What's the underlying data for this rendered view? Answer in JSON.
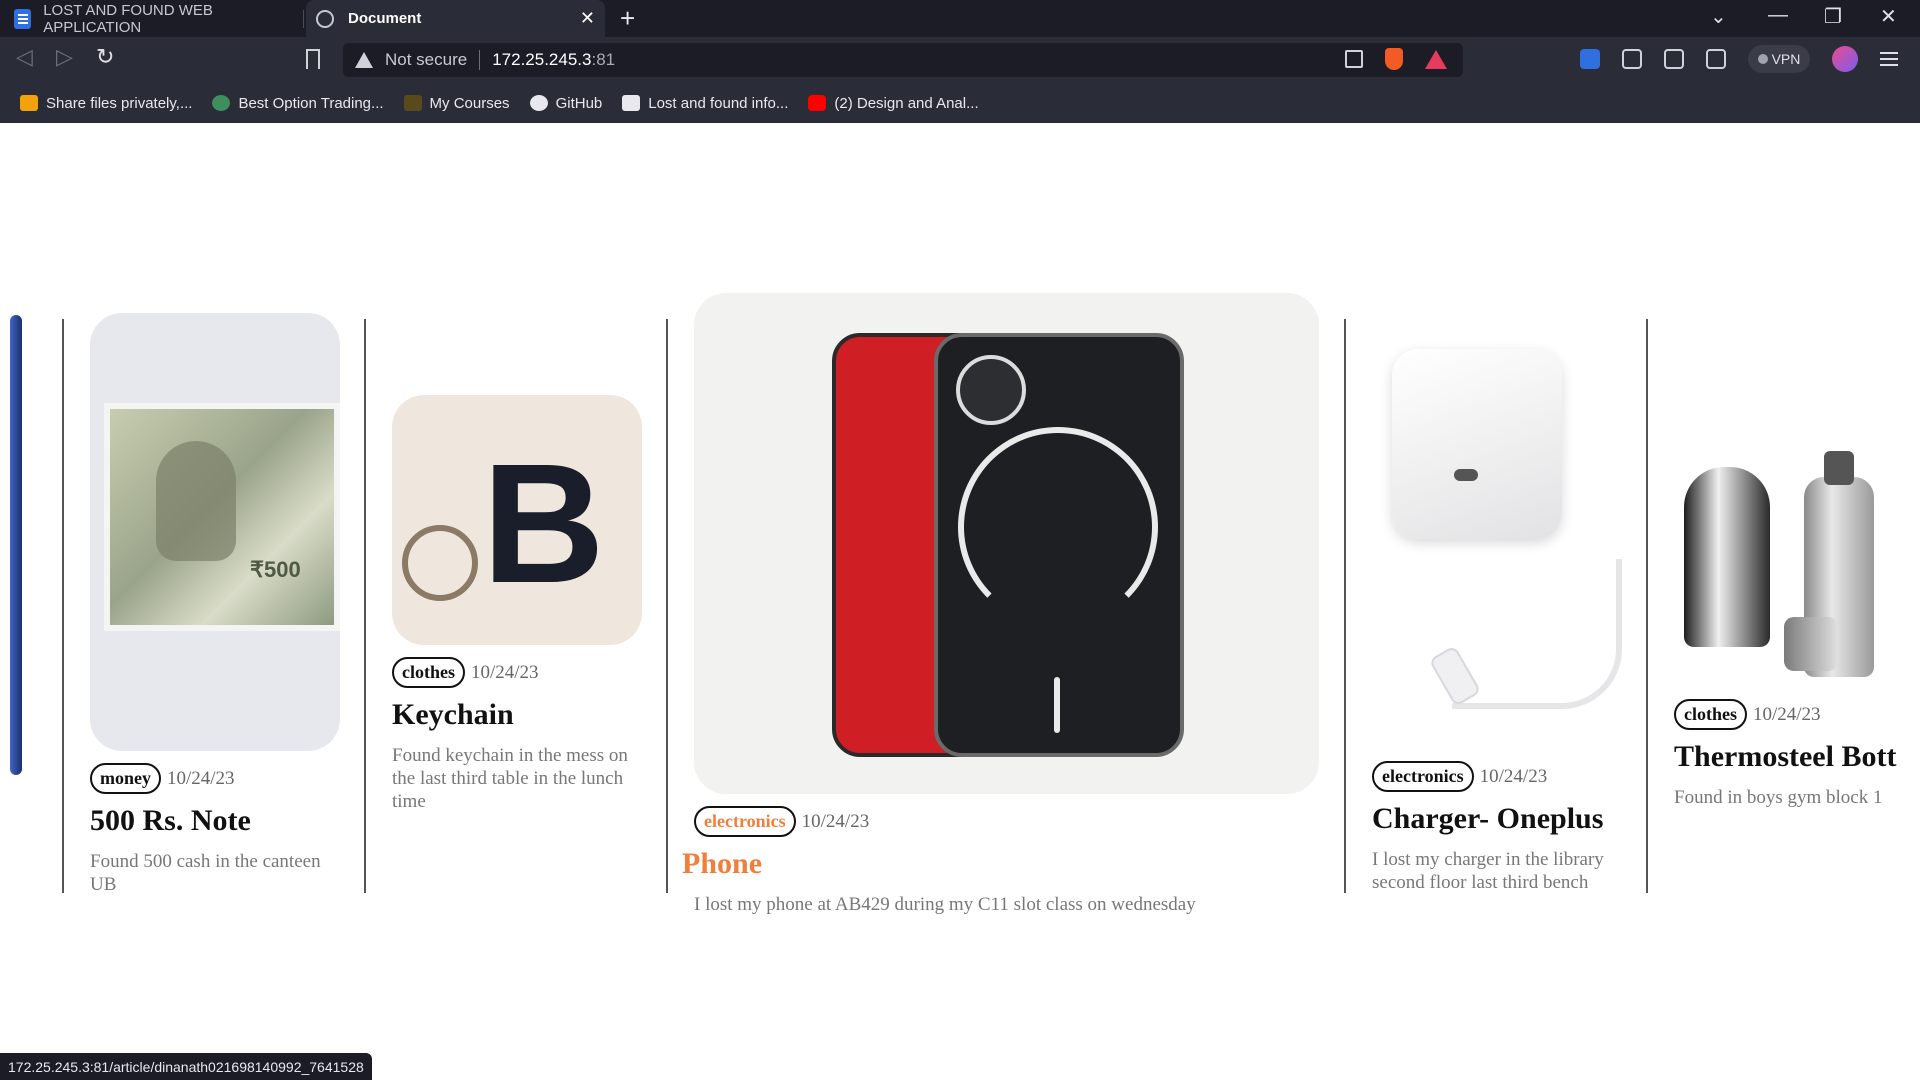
{
  "browser": {
    "tabs": [
      {
        "label": "LOST AND FOUND WEB APPLICATION",
        "active": false
      },
      {
        "label": "Document",
        "active": true
      }
    ],
    "address": {
      "security_label": "Not secure",
      "host": "172.25.245.3",
      "port": ":81"
    },
    "vpn_label": "VPN",
    "bookmarks": [
      {
        "label": "Share files privately,...",
        "icon": "share-files-icon"
      },
      {
        "label": "Best Option Trading...",
        "icon": "trading-icon"
      },
      {
        "label": "My Courses",
        "icon": "courses-icon"
      },
      {
        "label": "GitHub",
        "icon": "github-icon"
      },
      {
        "label": "Lost and found info...",
        "icon": "lost-found-icon"
      },
      {
        "label": "(2) Design and Anal...",
        "icon": "youtube-icon"
      }
    ],
    "status_url": "172.25.245.3:81/article/dinanath021698140992_7641528"
  },
  "cards": [
    {
      "tag": "money",
      "date": "10/24/23",
      "title": "500 Rs. Note",
      "description": "Found 500 cash in the canteen UB",
      "image": "500-rupee-note"
    },
    {
      "tag": "clothes",
      "date": "10/24/23",
      "title": "Keychain",
      "description": "Found keychain in the mess on the last third table in the lunch time",
      "image": "keychain"
    },
    {
      "tag": "electronics",
      "date": "10/24/23",
      "title": "Phone",
      "description": "I lost my phone at AB429 during my C11 slot class on wednesday",
      "image": "phone",
      "featured": true
    },
    {
      "tag": "electronics",
      "date": "10/24/23",
      "title": "Charger- Oneplus",
      "description": "I lost my charger in the library second floor last third bench",
      "image": "charger"
    },
    {
      "tag": "clothes",
      "date": "10/24/23",
      "title": "Thermosteel Bott",
      "description": "Found in boys gym block 1",
      "image": "thermosteel-bottle"
    }
  ],
  "colors": {
    "accent": "#f07f3c",
    "chrome_dark": "#1b1c25",
    "chrome": "#2a2c38"
  }
}
